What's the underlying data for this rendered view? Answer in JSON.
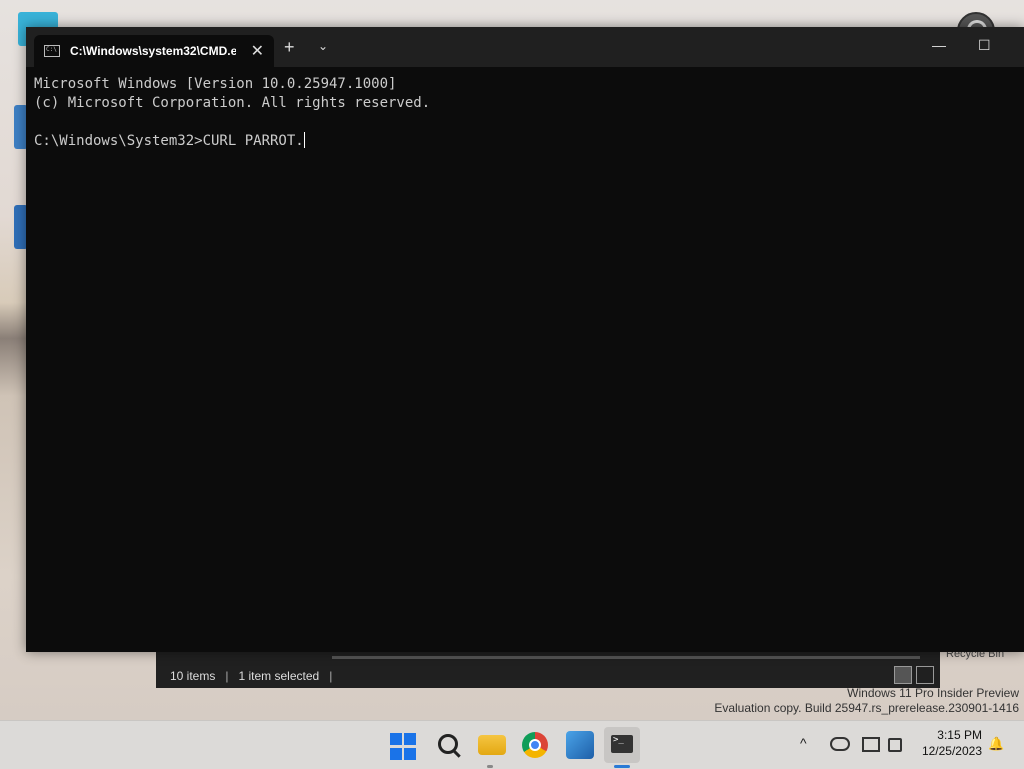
{
  "terminal": {
    "tab_title": "C:\\Windows\\system32\\CMD.e",
    "tab_close": "✕",
    "new_tab": "+",
    "dropdown": "⌄",
    "minimize": "—",
    "maximize": "☐",
    "lines": [
      "Microsoft Windows [Version 10.0.25947.1000]",
      "(c) Microsoft Corporation. All rights reserved.",
      "",
      "C:\\Windows\\System32>CURL PARROT."
    ]
  },
  "explorer": {
    "item_count": "10 items",
    "selection": "1 item selected",
    "sep": "|"
  },
  "desktop": {
    "recycle_bin": "Recycle Bin",
    "watermark_line1": "Windows 11 Pro Insider Preview",
    "watermark_line2": "Evaluation copy. Build 25947.rs_prerelease.230901-1416"
  },
  "taskbar": {
    "time": "3:15 PM",
    "date": "12/25/2023",
    "chevron": "^",
    "bell": "🔔",
    "terminal_glyph": ">_"
  }
}
